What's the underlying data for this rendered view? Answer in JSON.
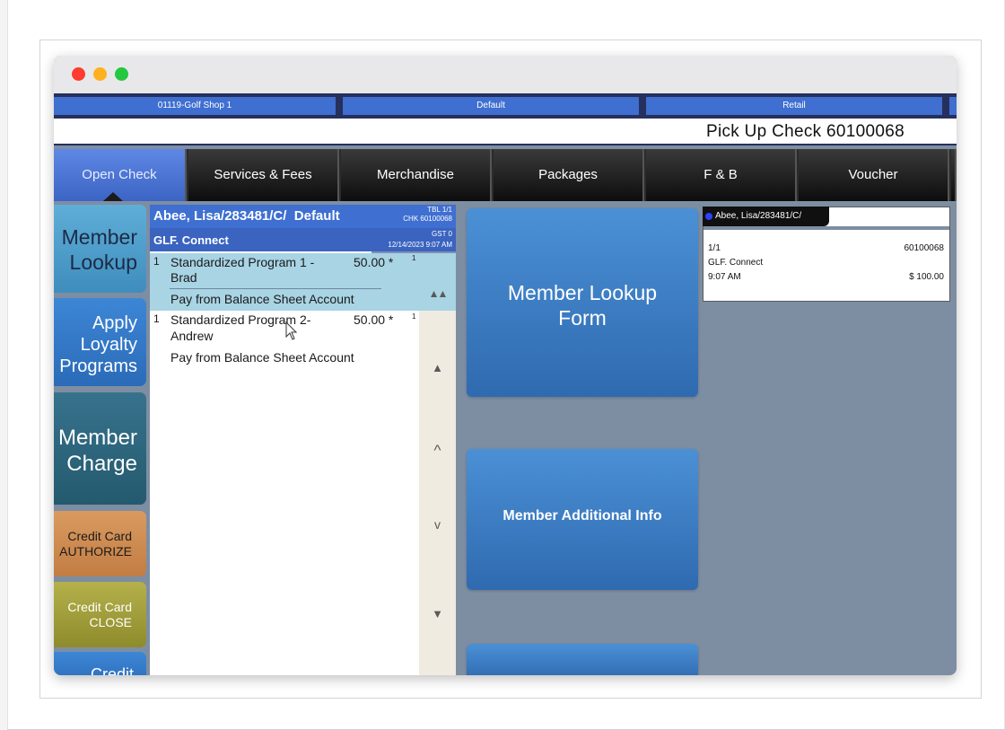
{
  "header": {
    "location": "01119-Golf Shop 1",
    "profile": "Default",
    "mode": "Retail",
    "check_title": "Pick Up Check 60100068"
  },
  "tabs": [
    {
      "label": "Open Check"
    },
    {
      "label": "Services & Fees"
    },
    {
      "label": "Merchandise"
    },
    {
      "label": "Packages"
    },
    {
      "label": "F & B"
    },
    {
      "label": "Voucher"
    }
  ],
  "left_buttons": {
    "lookup": [
      "Member",
      "Lookup"
    ],
    "loyalty": [
      "Apply",
      "Loyalty",
      "Programs"
    ],
    "charge": [
      "Member",
      "Charge"
    ],
    "authorize": [
      "Credit Card",
      "AUTHORIZE"
    ],
    "close": [
      "Credit Card",
      "CLOSE"
    ],
    "credit": "Credit"
  },
  "check": {
    "member": "Abee, Lisa/283481/C/",
    "profile": "Default",
    "tbl": "TBL 1/1",
    "chk": "CHK 60100068",
    "group": "GLF. Connect",
    "gst": "GST 0",
    "datetime": "12/14/2023 9:07 AM",
    "items": [
      {
        "qty": "1",
        "name1": "Standardized Program 1 -",
        "name2": "Brad",
        "price": "50.00 *",
        "seat": "1",
        "note": "Pay from Balance Sheet Account"
      },
      {
        "qty": "1",
        "name1": "Standardized Program 2-",
        "name2": "Andrew",
        "price": "50.00 *",
        "seat": "1",
        "note": "Pay from Balance Sheet Account"
      }
    ]
  },
  "scroll": {
    "page_up": "▲▲",
    "up": "▲",
    "line_up": "^",
    "line_down": "v",
    "down": "▼"
  },
  "actions": {
    "lookup_form": [
      "Member Lookup",
      "Form"
    ],
    "additional_info": "Member Additional Info"
  },
  "summary": {
    "tab": "Abee, Lisa/283481/C/",
    "seat": "1/1",
    "check_no": "60100068",
    "group": "GLF. Connect",
    "time": "9:07 AM",
    "total": "$ 100.00"
  },
  "colors": {
    "accent": "#3f6fd0",
    "navy": "#26305c",
    "bg_panel": "#7d8ea3"
  }
}
